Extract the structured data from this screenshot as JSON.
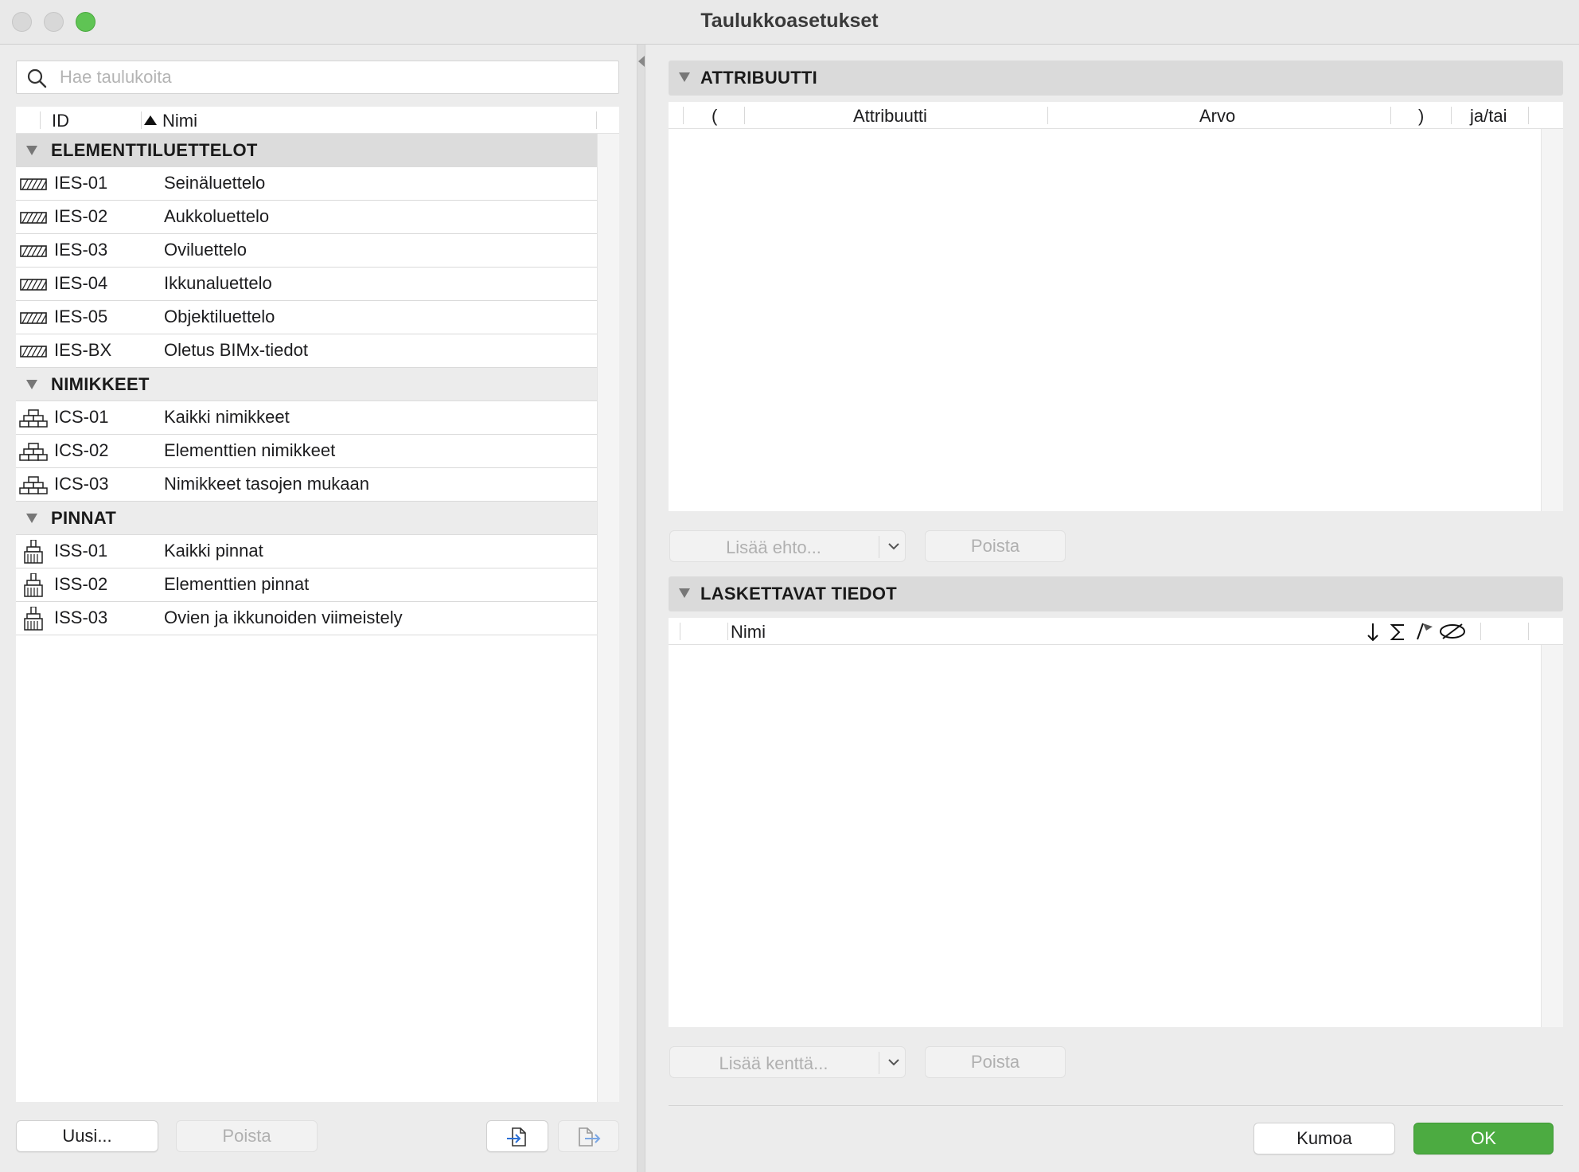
{
  "window": {
    "title": "Taulukkoasetukset"
  },
  "search": {
    "placeholder": "Hae taulukoita"
  },
  "list": {
    "headers": {
      "id": "ID",
      "name": "Nimi"
    },
    "groups": [
      {
        "label": "ELEMENTTILUETTELOT",
        "icon": "hatched-element-icon",
        "items": [
          {
            "id": "IES-01",
            "name": "Seinäluettelo"
          },
          {
            "id": "IES-02",
            "name": "Aukkoluettelo"
          },
          {
            "id": "IES-03",
            "name": "Oviluettelo"
          },
          {
            "id": "IES-04",
            "name": "Ikkunaluettelo"
          },
          {
            "id": "IES-05",
            "name": "Objektiluettelo"
          },
          {
            "id": "IES-BX",
            "name": "Oletus BIMx-tiedot"
          }
        ]
      },
      {
        "label": "NIMIKKEET",
        "icon": "brick-component-icon",
        "items": [
          {
            "id": "ICS-01",
            "name": "Kaikki nimikkeet"
          },
          {
            "id": "ICS-02",
            "name": "Elementtien nimikkeet"
          },
          {
            "id": "ICS-03",
            "name": "Nimikkeet tasojen mukaan"
          }
        ]
      },
      {
        "label": "PINNAT",
        "icon": "paint-brush-icon",
        "items": [
          {
            "id": "ISS-01",
            "name": "Kaikki pinnat"
          },
          {
            "id": "ISS-02",
            "name": "Elementtien pinnat"
          },
          {
            "id": "ISS-03",
            "name": "Ovien ja ikkunoiden viimeistely"
          }
        ]
      }
    ]
  },
  "left_buttons": {
    "new": "Uusi...",
    "delete": "Poista"
  },
  "attribute_section": {
    "title": "ATTRIBUUTTI",
    "columns": {
      "open_paren": "(",
      "attribute": "Attribuutti",
      "value": "Arvo",
      "close_paren": ")",
      "and_or": "ja/tai"
    },
    "add_label": "Lisää ehto...",
    "delete_label": "Poista"
  },
  "fields_section": {
    "title": "LASKETTAVAT TIEDOT",
    "columns": {
      "name": "Nimi"
    },
    "add_label": "Lisää kenttä...",
    "delete_label": "Poista"
  },
  "footer": {
    "cancel": "Kumoa",
    "ok": "OK"
  },
  "colors": {
    "accent_ok": "#4cab41",
    "traffic_green": "#5fc454"
  }
}
